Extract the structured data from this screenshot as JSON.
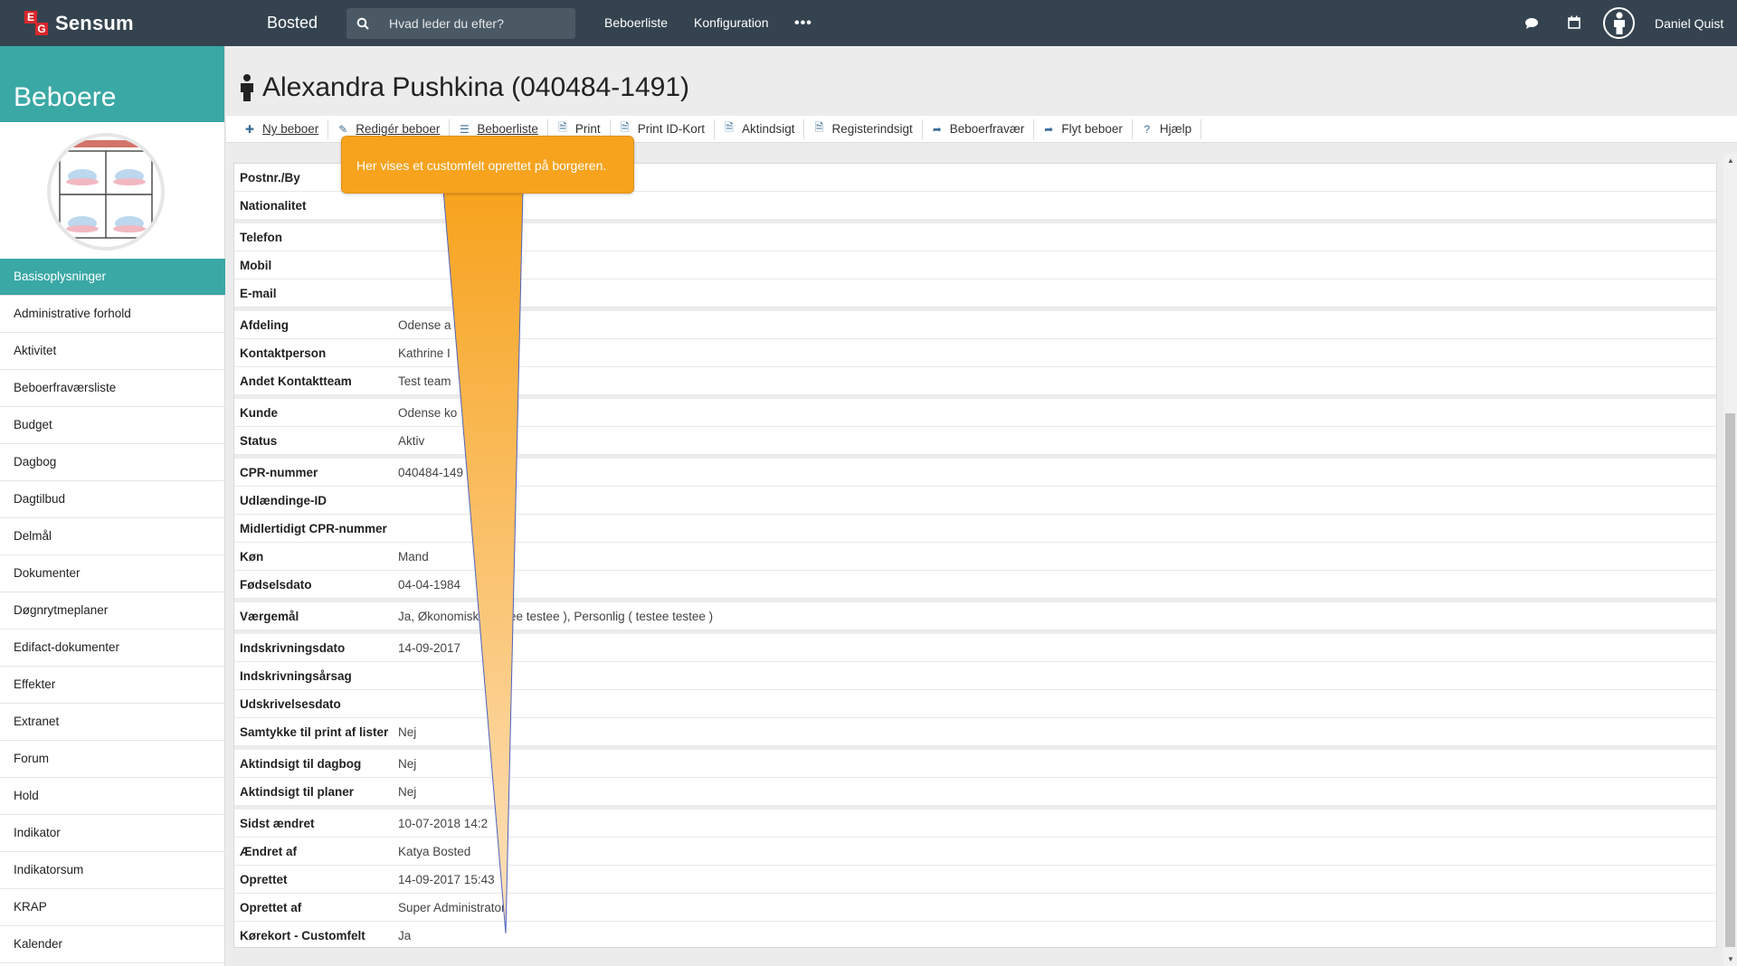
{
  "topbar": {
    "logo_text": "Sensum",
    "app_title": "Bosted",
    "search_placeholder": "Hvad leder du efter?",
    "nav": [
      "Beboerliste",
      "Konfiguration"
    ],
    "more": "•••",
    "user_name": "Daniel Quist"
  },
  "sidebar": {
    "title": "Beboere",
    "items": [
      "Basisoplysninger",
      "Administrative forhold",
      "Aktivitet",
      "Beboerfraværsliste",
      "Budget",
      "Dagbog",
      "Dagtilbud",
      "Delmål",
      "Dokumenter",
      "Døgnrytmeplaner",
      "Edifact-dokumenter",
      "Effekter",
      "Extranet",
      "Forum",
      "Hold",
      "Indikator",
      "Indikatorsum",
      "KRAP",
      "Kalender"
    ],
    "active_index": 0
  },
  "page": {
    "title": "Alexandra Pushkina (040484-1491)"
  },
  "toolbar": [
    {
      "icon": "plus-icon",
      "label": "Ny beboer"
    },
    {
      "icon": "pencil-icon",
      "label": "Redigér beboer"
    },
    {
      "icon": "list-icon",
      "label": "Beboerliste"
    },
    {
      "icon": "pdf-icon",
      "label": "Print"
    },
    {
      "icon": "pdf-icon",
      "label": "Print ID-Kort"
    },
    {
      "icon": "pdf-icon",
      "label": "Aktindsigt"
    },
    {
      "icon": "pdf-icon",
      "label": "Registerindsigt"
    },
    {
      "icon": "exit-icon",
      "label": "Beboerfravær"
    },
    {
      "icon": "exit-icon",
      "label": "Flyt beboer"
    },
    {
      "icon": "question-icon",
      "label": "Hjælp"
    }
  ],
  "tooltip": {
    "text": "Her vises et customfelt oprettet på borgeren."
  },
  "details": {
    "groups": [
      [
        {
          "k": "Postnr./By",
          "v": ""
        },
        {
          "k": "Nationalitet",
          "v": ""
        }
      ],
      [
        {
          "k": "Telefon",
          "v": ""
        },
        {
          "k": "Mobil",
          "v": ""
        },
        {
          "k": "E-mail",
          "v": ""
        }
      ],
      [
        {
          "k": "Afdeling",
          "v": "Odense a"
        },
        {
          "k": "Kontaktperson",
          "v": "Kathrine I"
        },
        {
          "k": "Andet Kontaktteam",
          "v": "Test team"
        }
      ],
      [
        {
          "k": "Kunde",
          "v": "Odense ko"
        },
        {
          "k": "Status",
          "v": "Aktiv"
        }
      ],
      [
        {
          "k": "CPR-nummer",
          "v": "040484-149"
        },
        {
          "k": "Udlændinge-ID",
          "v": ""
        },
        {
          "k": "Midlertidigt CPR-nummer",
          "v": ""
        },
        {
          "k": "Køn",
          "v": "Mand"
        },
        {
          "k": "Fødselsdato",
          "v": "04-04-1984"
        }
      ],
      [
        {
          "k": "Værgemål",
          "v": "Ja, Økonomisk ( testee testee ), Personlig ( testee testee )"
        }
      ],
      [
        {
          "k": "Indskrivningsdato",
          "v": "14-09-2017"
        },
        {
          "k": "Indskrivningsårsag",
          "v": ""
        },
        {
          "k": "Udskrivelsesdato",
          "v": ""
        },
        {
          "k": "Samtykke til print af lister",
          "v": "Nej"
        }
      ],
      [
        {
          "k": "Aktindsigt til dagbog",
          "v": "Nej"
        },
        {
          "k": "Aktindsigt til planer",
          "v": "Nej"
        }
      ],
      [
        {
          "k": "Sidst ændret",
          "v": "10-07-2018 14:2"
        },
        {
          "k": "Ændret af",
          "v": "Katya Bosted"
        },
        {
          "k": "Oprettet",
          "v": "14-09-2017 15:43"
        },
        {
          "k": "Oprettet af",
          "v": "Super Administrator"
        },
        {
          "k": "Kørekort - Customfelt",
          "v": "Ja"
        }
      ]
    ]
  },
  "colors": {
    "topbar": "#34434f",
    "accent": "#3aa8a5",
    "tooltip": "#f7a31d"
  }
}
